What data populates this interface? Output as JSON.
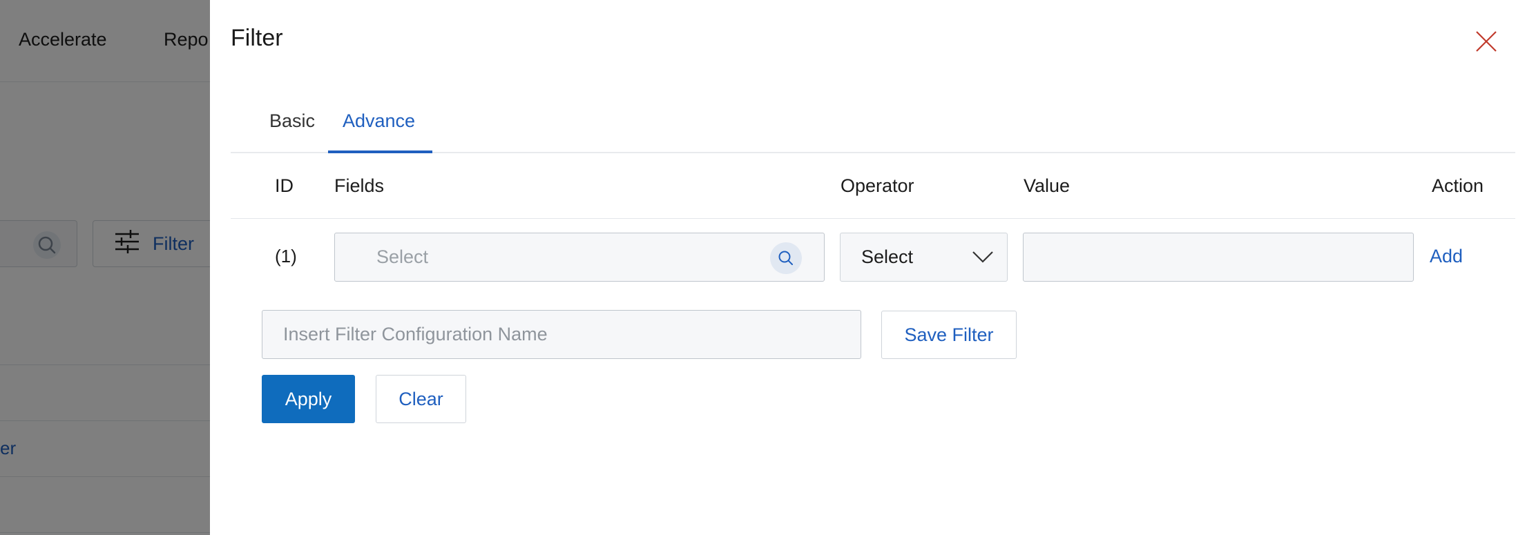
{
  "background": {
    "nav_items": [
      "Accelerate",
      "Repo"
    ],
    "filter_button_label": "Filter",
    "partial_link_text": "er"
  },
  "drawer": {
    "title": "Filter",
    "tabs": [
      {
        "label": "Basic",
        "active": false
      },
      {
        "label": "Advance",
        "active": true
      }
    ],
    "table": {
      "headers": {
        "id": "ID",
        "fields": "Fields",
        "operator": "Operator",
        "value": "Value",
        "action": "Action"
      },
      "rows": [
        {
          "id": "(1)",
          "fields_placeholder": "Select",
          "operator_value": "Select",
          "value": "",
          "action_label": "Add"
        }
      ]
    },
    "config_name_placeholder": "Insert Filter Configuration Name",
    "save_filter_label": "Save Filter",
    "apply_label": "Apply",
    "clear_label": "Clear"
  },
  "colors": {
    "accent": "#1f5fbf",
    "primary_button": "#0f6cbd",
    "close_icon": "#c0392b",
    "overlay": "rgba(0,0,0,0.5)"
  },
  "icons": {
    "close": "close-icon",
    "search": "search-icon",
    "chevron": "chevron-down-icon",
    "filter": "sliders-icon"
  }
}
